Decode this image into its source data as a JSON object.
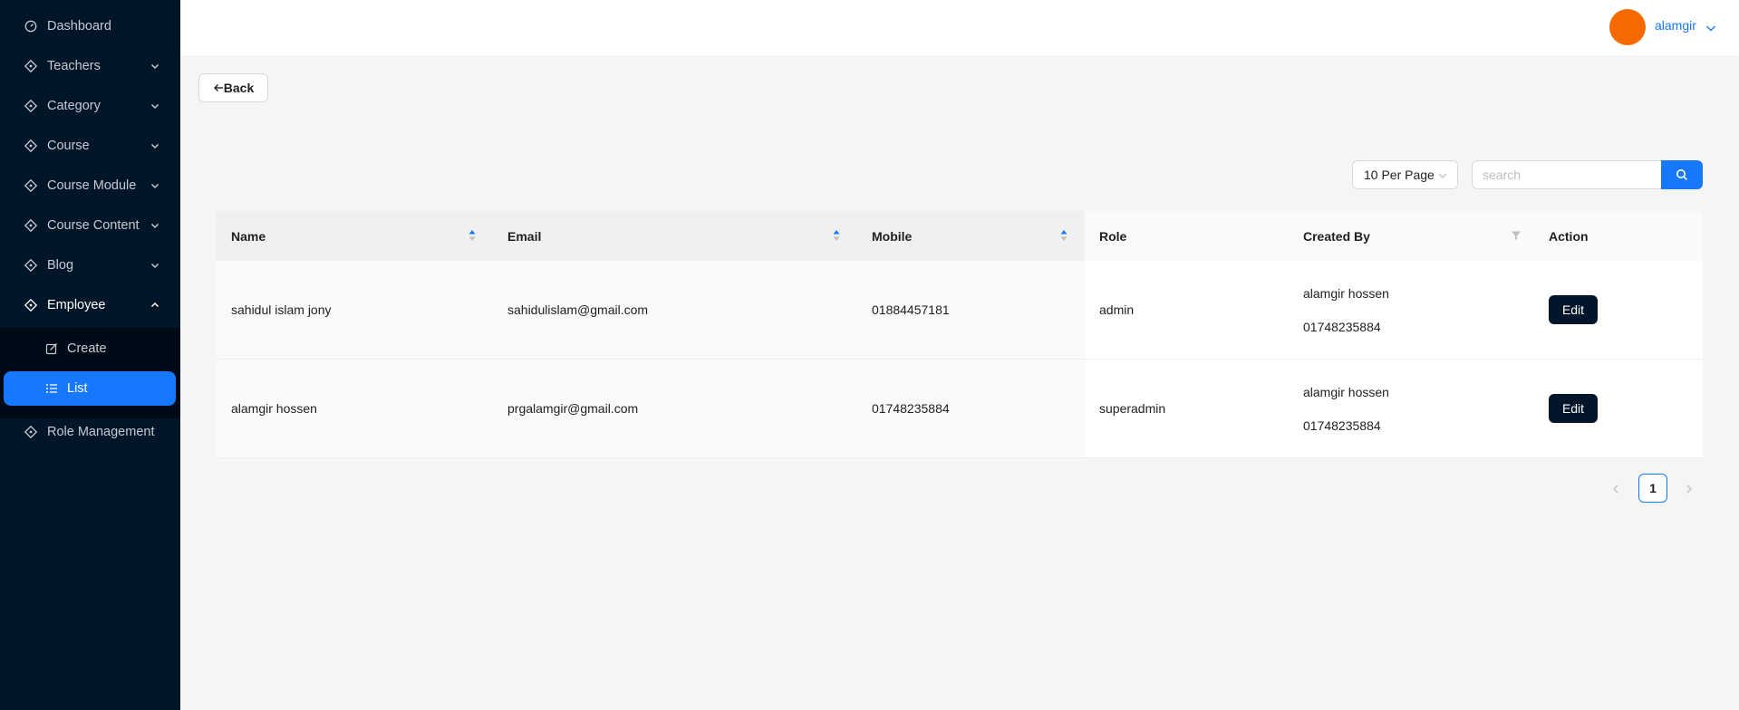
{
  "sidebar": {
    "items": [
      {
        "label": "Dashboard"
      },
      {
        "label": "Teachers"
      },
      {
        "label": "Category"
      },
      {
        "label": "Course"
      },
      {
        "label": "Course Module"
      },
      {
        "label": "Course Content"
      },
      {
        "label": "Blog"
      },
      {
        "label": "Employee"
      },
      {
        "label": "Role Management"
      }
    ],
    "employee_submenu": [
      {
        "label": "Create"
      },
      {
        "label": "List"
      }
    ]
  },
  "header": {
    "username": "alamgir",
    "avatar_color": "#f56a00"
  },
  "toolbar": {
    "back_label": "Back",
    "per_page": "10 Per Page",
    "search_placeholder": "search"
  },
  "table": {
    "columns": [
      "Name",
      "Email",
      "Mobile",
      "Role",
      "Created By",
      "Action"
    ],
    "rows": [
      {
        "name": "sahidul islam jony",
        "email": "sahidulislam@gmail.com",
        "mobile": "01884457181",
        "role": "admin",
        "created_by_name": "alamgir hossen",
        "created_by_mobile": "01748235884",
        "action": "Edit"
      },
      {
        "name": "alamgir hossen",
        "email": "prgalamgir@gmail.com",
        "mobile": "01748235884",
        "role": "superadmin",
        "created_by_name": "alamgir hossen",
        "created_by_mobile": "01748235884",
        "action": "Edit"
      }
    ]
  },
  "pagination": {
    "current_page": "1"
  },
  "colors": {
    "sidebar_bg": "#011528",
    "accent": "#1677ff",
    "edit_button": "#001529"
  }
}
